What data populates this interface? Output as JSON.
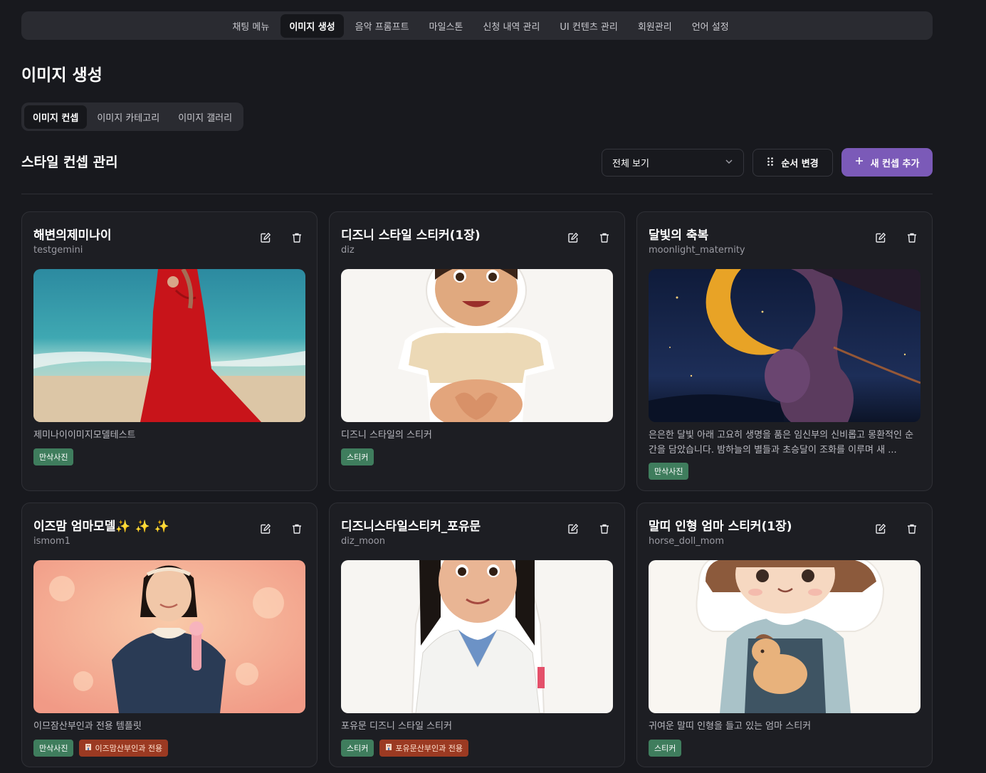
{
  "topnav": {
    "items": [
      {
        "label": "채팅 메뉴",
        "active": false
      },
      {
        "label": "이미지 생성",
        "active": true
      },
      {
        "label": "음악 프롬프트",
        "active": false
      },
      {
        "label": "마일스톤",
        "active": false
      },
      {
        "label": "신청 내역 관리",
        "active": false
      },
      {
        "label": "UI 컨텐츠 관리",
        "active": false
      },
      {
        "label": "회원관리",
        "active": false
      },
      {
        "label": "언어 설정",
        "active": false
      }
    ]
  },
  "page": {
    "title": "이미지 생성"
  },
  "subtabs": {
    "items": [
      {
        "label": "이미지 컨셉",
        "active": true
      },
      {
        "label": "이미지 카테고리",
        "active": false
      },
      {
        "label": "이미지 갤러리",
        "active": false
      }
    ]
  },
  "section": {
    "title": "스타일 컨셉 관리",
    "filter_value": "전체 보기",
    "reorder_label": "순서 변경",
    "add_label": "새 컨셉 추가"
  },
  "cards": [
    {
      "title": "해변의제미나이",
      "slug": "testgemini",
      "description": "제미나이이미지모델테스트",
      "image_subject": "pregnant woman in red dress on beach",
      "tags": [
        {
          "label": "만삭사진",
          "style": "green"
        }
      ]
    },
    {
      "title": "디즈니 스타일 스티커(1장)",
      "slug": "diz",
      "description": "디즈니 스타일의 스티커",
      "image_subject": "cartoon girl making heart on belly sticker",
      "tags": [
        {
          "label": "스티커",
          "style": "green"
        }
      ]
    },
    {
      "title": "달빛의 축복",
      "slug": "moonlight_maternity",
      "description": "은은한 달빛 아래 고요히 생명을 품은 임신부의 신비롭고 몽환적인 순간을 담았습니다. 밤하늘의 별들과 초승달이 조화를 이루며 새 ...",
      "image_subject": "pregnant woman silhouette with crescent moon at night",
      "tags": [
        {
          "label": "만삭사진",
          "style": "green"
        }
      ]
    },
    {
      "title": "이즈맘 엄마모델✨ ✨ ✨",
      "slug": "ismom1",
      "description": "이므잠산부인과 전용 템플릿",
      "image_subject": "woman in navy dress holding pink microphone with heart bokeh",
      "tags": [
        {
          "label": "만삭사진",
          "style": "green"
        },
        {
          "label": "이즈맘산부인과 전용",
          "style": "orange"
        }
      ]
    },
    {
      "title": "디즈니스타일스티커_포유문",
      "slug": "diz_moon",
      "description": "포유문 디즈니 스타일 스티커",
      "image_subject": "cartoon doctor girl in white coat sticker",
      "tags": [
        {
          "label": "스티커",
          "style": "green"
        },
        {
          "label": "포유문산부인과 전용",
          "style": "orange"
        }
      ]
    },
    {
      "title": "말띠 인형 엄마 스티커(1장)",
      "slug": "horse_doll_mom",
      "description": "귀여운 말띠 인형을 들고 있는 엄마 스티커",
      "image_subject": "chibi mom holding horse doll sticker",
      "tags": [
        {
          "label": "스티커",
          "style": "green"
        }
      ]
    }
  ],
  "icons": {
    "edit": "edit-icon",
    "delete": "trash-icon",
    "chevron": "chevron-down-icon",
    "grip": "grip-dots-icon",
    "plus": "plus-icon",
    "building": "building-icon"
  },
  "colors": {
    "background": "#18191e",
    "card": "#1d1e23",
    "accent": "#7b5ab8",
    "tag_green": "#3f7d5d",
    "tag_orange": "#9b3a22"
  }
}
